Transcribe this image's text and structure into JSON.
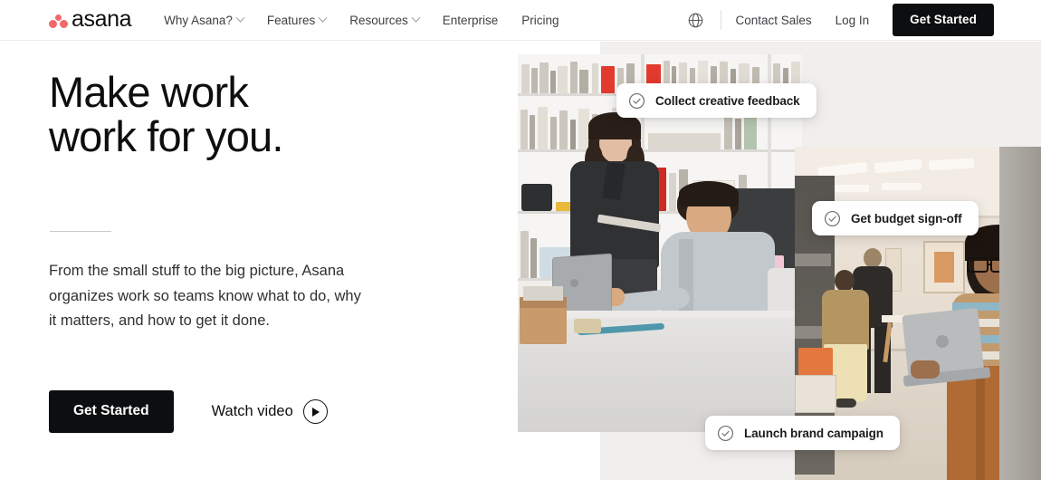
{
  "brand": {
    "logo_text": "asana",
    "logo_dot_color": "#f06a6a",
    "accent_dark": "#0d0e10"
  },
  "header": {
    "nav_items": [
      {
        "label": "Why Asana?",
        "has_dropdown": true
      },
      {
        "label": "Features",
        "has_dropdown": true
      },
      {
        "label": "Resources",
        "has_dropdown": true
      },
      {
        "label": "Enterprise",
        "has_dropdown": false
      },
      {
        "label": "Pricing",
        "has_dropdown": false
      }
    ],
    "globe_icon": "globe-icon",
    "contact_sales_label": "Contact Sales",
    "log_in_label": "Log In",
    "get_started_label": "Get Started"
  },
  "hero": {
    "headline_line_1": "Make work",
    "headline_line_2": "work for you.",
    "subcopy": "From the small stuff to the big picture, Asana organizes work so teams know what to do, why it matters, and how to get it done.",
    "primary_cta_label": "Get Started",
    "video_label": "Watch video",
    "video_icon": "play-circle-icon"
  },
  "floating_cards": [
    {
      "icon": "check-circle-icon",
      "label": "Collect creative feedback"
    },
    {
      "icon": "check-circle-icon",
      "label": "Get budget sign-off"
    },
    {
      "icon": "check-circle-icon",
      "label": "Launch brand campaign"
    }
  ],
  "imagery": {
    "main_photo_alt": "Two coworkers in a bright studio office, one standing with a tablet and one seated working on a laptop",
    "side_photo_alt": "Woman with glasses holding a laptop in an open warehouse-style office with colleagues walking in the background",
    "panel_background": "#f1efed"
  }
}
